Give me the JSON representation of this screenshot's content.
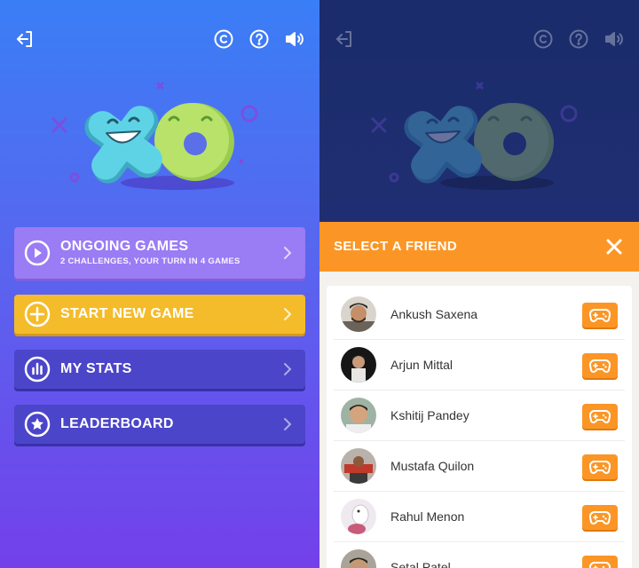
{
  "left": {
    "top_icons": [
      "logout-icon",
      "copyright-icon",
      "help-icon",
      "volume-icon"
    ],
    "menu": {
      "ongoing": {
        "title": "ONGOING GAMES",
        "subtitle": "2 CHALLENGES, YOUR TURN IN 4 GAMES",
        "icon": "play-icon"
      },
      "new_game": {
        "title": "START NEW GAME",
        "icon": "plus-icon"
      },
      "stats": {
        "title": "MY STATS",
        "icon": "stats-icon"
      },
      "leaderboard": {
        "title": "LEADERBOARD",
        "icon": "star-icon"
      }
    }
  },
  "right": {
    "sheet_title": "SELECT A FRIEND",
    "friends": [
      {
        "name": "Ankush Saxena"
      },
      {
        "name": "Arjun Mittal"
      },
      {
        "name": "Kshitij Pandey"
      },
      {
        "name": "Mustafa Quilon"
      },
      {
        "name": "Rahul Menon"
      },
      {
        "name": "Setal Patel"
      }
    ]
  },
  "colors": {
    "orange": "#fb9626",
    "yellow": "#f4bc2a",
    "purple_light": "#9a7cf4",
    "indigo": "#4b45c9",
    "x_teal": "#5fd3e6",
    "o_green": "#b9e26a"
  }
}
